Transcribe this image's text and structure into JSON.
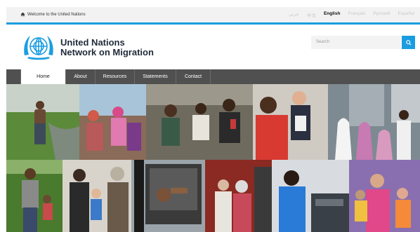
{
  "topbar": {
    "welcome": "Welcome to the United Nations",
    "languages": [
      "عربي",
      "中文",
      "English",
      "Français",
      "Русский",
      "Español"
    ],
    "active_language": "English"
  },
  "header": {
    "org_line1": "United Nations",
    "org_line2": "Network on Migration",
    "search_placeholder": "Search"
  },
  "nav": {
    "items": [
      {
        "label": "Home",
        "active": true
      },
      {
        "label": "About",
        "active": false
      },
      {
        "label": "Resources",
        "active": false
      },
      {
        "label": "Statements",
        "active": false
      },
      {
        "label": "Contact",
        "active": false
      }
    ]
  },
  "colors": {
    "accent": "#1a9de0",
    "nav_bg": "#505050",
    "title": "#1f2a38"
  },
  "icons": {
    "home": "home-icon",
    "search": "search-icon",
    "logo": "un-emblem"
  }
}
